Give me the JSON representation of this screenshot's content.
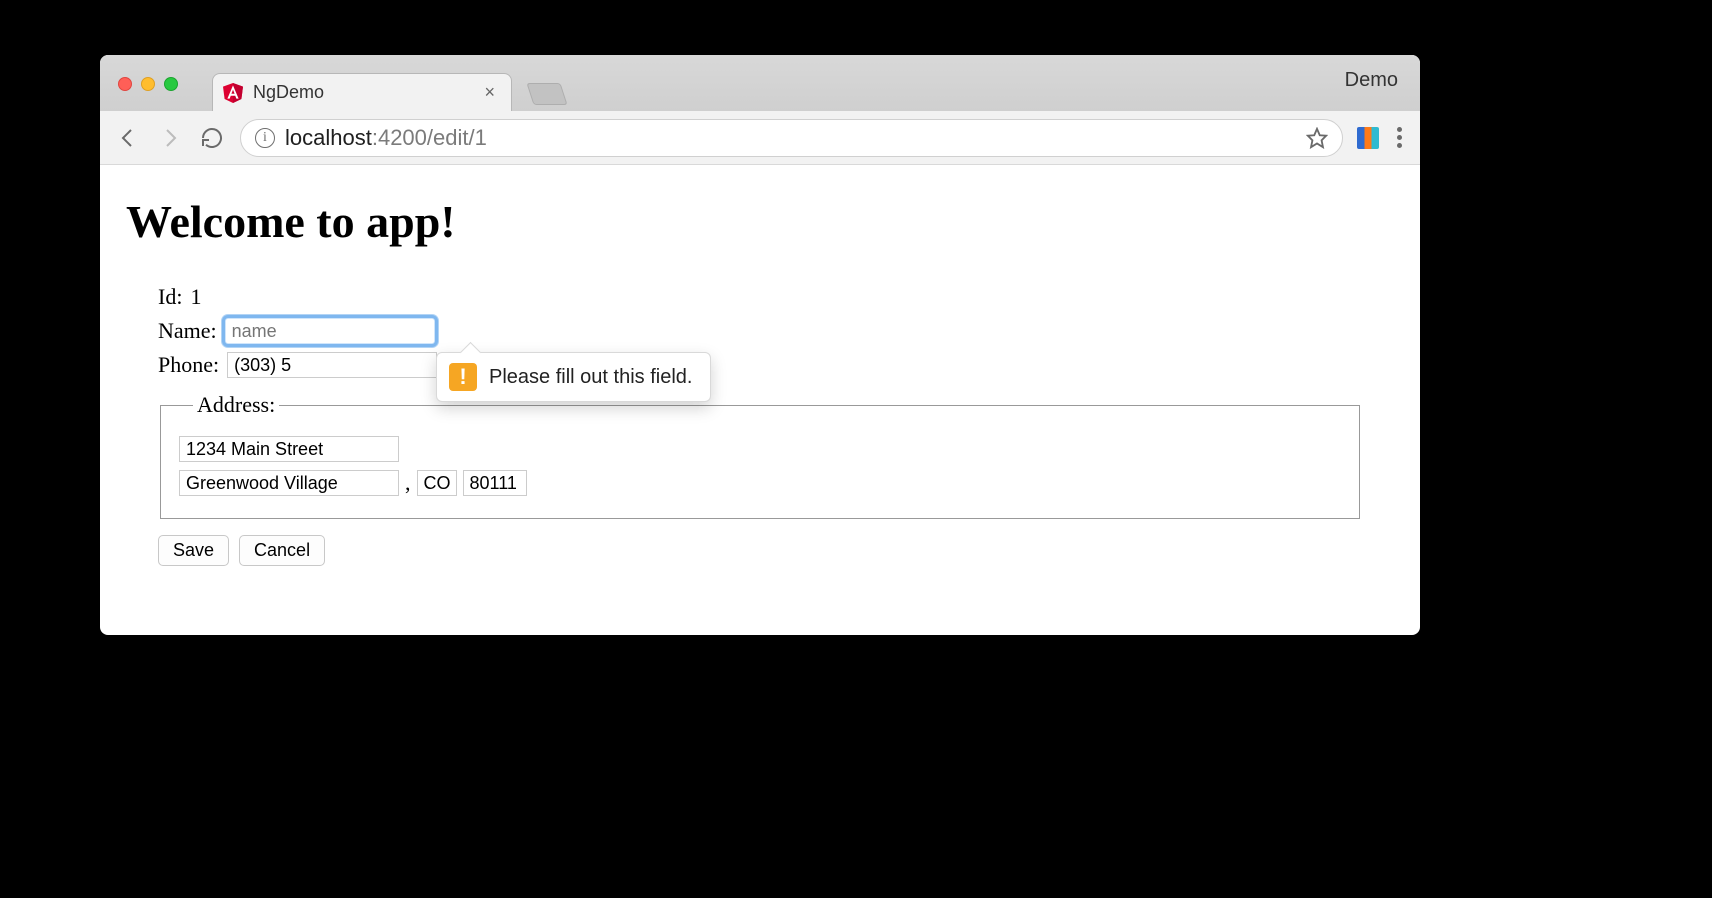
{
  "browser": {
    "tab_title": "NgDemo",
    "profile_label": "Demo",
    "url": {
      "host": "localhost",
      "port_and_path": ":4200/edit/1",
      "full": "localhost:4200/edit/1"
    }
  },
  "page": {
    "heading": "Welcome to app!"
  },
  "form": {
    "id_label": "Id:",
    "id_value": "1",
    "name_label": "Name:",
    "name_placeholder": "name",
    "name_value": "",
    "phone_label": "Phone:",
    "phone_value": "(303) 5",
    "address_legend": "Address:",
    "street_value": "1234 Main Street",
    "city_value": "Greenwood Village",
    "city_state_separator": ",",
    "state_value": "CO",
    "zip_value": "80111"
  },
  "buttons": {
    "save": "Save",
    "cancel": "Cancel"
  },
  "validation": {
    "message": "Please fill out this field."
  },
  "icons": {
    "warn_glyph": "!",
    "info_glyph": "i",
    "close_glyph": "×"
  }
}
